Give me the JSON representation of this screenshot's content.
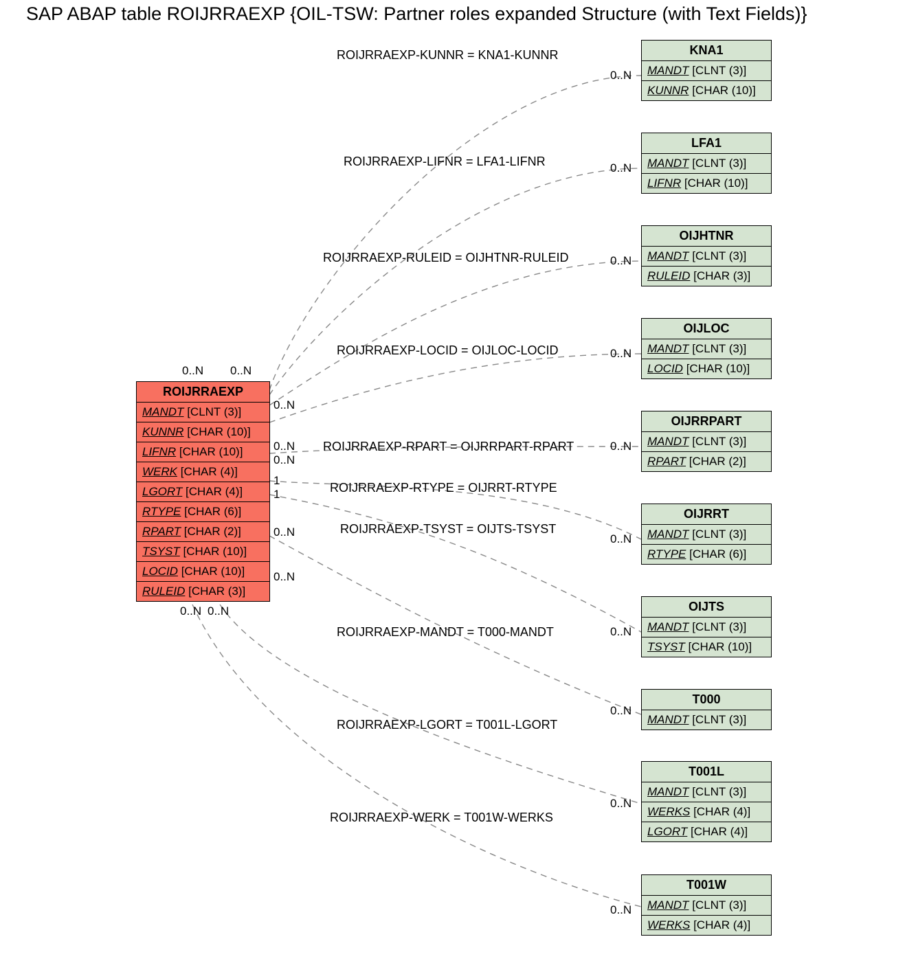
{
  "title": "SAP ABAP table ROIJRRAEXP {OIL-TSW: Partner roles expanded Structure (with Text Fields)}",
  "main_entity": {
    "name": "ROIJRRAEXP",
    "fields": [
      {
        "name": "MANDT",
        "type": "[CLNT (3)]"
      },
      {
        "name": "KUNNR",
        "type": "[CHAR (10)]"
      },
      {
        "name": "LIFNR",
        "type": "[CHAR (10)]"
      },
      {
        "name": "WERK",
        "type": "[CHAR (4)]"
      },
      {
        "name": "LGORT",
        "type": "[CHAR (4)]"
      },
      {
        "name": "RTYPE",
        "type": "[CHAR (6)]"
      },
      {
        "name": "RPART",
        "type": "[CHAR (2)]"
      },
      {
        "name": "TSYST",
        "type": "[CHAR (10)]"
      },
      {
        "name": "LOCID",
        "type": "[CHAR (10)]"
      },
      {
        "name": "RULEID",
        "type": "[CHAR (3)]"
      }
    ]
  },
  "related_entities": [
    {
      "name": "KNA1",
      "fields": [
        {
          "name": "MANDT",
          "type": "[CLNT (3)]"
        },
        {
          "name": "KUNNR",
          "type": "[CHAR (10)]"
        }
      ]
    },
    {
      "name": "LFA1",
      "fields": [
        {
          "name": "MANDT",
          "type": "[CLNT (3)]"
        },
        {
          "name": "LIFNR",
          "type": "[CHAR (10)]"
        }
      ]
    },
    {
      "name": "OIJHTNR",
      "fields": [
        {
          "name": "MANDT",
          "type": "[CLNT (3)]"
        },
        {
          "name": "RULEID",
          "type": "[CHAR (3)]"
        }
      ]
    },
    {
      "name": "OIJLOC",
      "fields": [
        {
          "name": "MANDT",
          "type": "[CLNT (3)]"
        },
        {
          "name": "LOCID",
          "type": "[CHAR (10)]"
        }
      ]
    },
    {
      "name": "OIJRRPART",
      "fields": [
        {
          "name": "MANDT",
          "type": "[CLNT (3)]"
        },
        {
          "name": "RPART",
          "type": "[CHAR (2)]"
        }
      ]
    },
    {
      "name": "OIJRRT",
      "fields": [
        {
          "name": "MANDT",
          "type": "[CLNT (3)]"
        },
        {
          "name": "RTYPE",
          "type": "[CHAR (6)]"
        }
      ]
    },
    {
      "name": "OIJTS",
      "fields": [
        {
          "name": "MANDT",
          "type": "[CLNT (3)]"
        },
        {
          "name": "TSYST",
          "type": "[CHAR (10)]"
        }
      ]
    },
    {
      "name": "T000",
      "fields": [
        {
          "name": "MANDT",
          "type": "[CLNT (3)]"
        }
      ]
    },
    {
      "name": "T001L",
      "fields": [
        {
          "name": "MANDT",
          "type": "[CLNT (3)]"
        },
        {
          "name": "WERKS",
          "type": "[CHAR (4)]"
        },
        {
          "name": "LGORT",
          "type": "[CHAR (4)]"
        }
      ]
    },
    {
      "name": "T001W",
      "fields": [
        {
          "name": "MANDT",
          "type": "[CLNT (3)]"
        },
        {
          "name": "WERKS",
          "type": "[CHAR (4)]"
        }
      ]
    }
  ],
  "relations": [
    {
      "label": "ROIJRRAEXP-KUNNR = KNA1-KUNNR",
      "left_card": "0..N",
      "right_card": "0..N"
    },
    {
      "label": "ROIJRRAEXP-LIFNR = LFA1-LIFNR",
      "left_card": "0..N",
      "right_card": "0..N"
    },
    {
      "label": "ROIJRRAEXP-RULEID = OIJHTNR-RULEID",
      "left_card": "0..N",
      "right_card": "0..N"
    },
    {
      "label": "ROIJRRAEXP-LOCID = OIJLOC-LOCID",
      "left_card": "0..N",
      "right_card": "0..N"
    },
    {
      "label": "ROIJRRAEXP-RPART = OIJRRPART-RPART",
      "left_card": "0..N",
      "right_card": "0..N"
    },
    {
      "label": "ROIJRRAEXP-RTYPE = OIJRRT-RTYPE",
      "left_card": "1",
      "right_card": "1"
    },
    {
      "label": "ROIJRRAEXP-TSYST = OIJTS-TSYST",
      "left_card": "0..N",
      "right_card": "0..N"
    },
    {
      "label": "ROIJRRAEXP-MANDT = T000-MANDT",
      "left_card": "0..N",
      "right_card": "0..N"
    },
    {
      "label": "ROIJRRAEXP-LGORT = T001L-LGORT",
      "left_card": "0..N",
      "right_card": "0..N"
    },
    {
      "label": "ROIJRRAEXP-WERK = T001W-WERKS",
      "left_card": "0..N",
      "right_card": "0..N"
    }
  ],
  "chart_data": {
    "type": "er-diagram",
    "main": "ROIJRRAEXP",
    "main_fields": [
      "MANDT CLNT(3)",
      "KUNNR CHAR(10)",
      "LIFNR CHAR(10)",
      "WERK CHAR(4)",
      "LGORT CHAR(4)",
      "RTYPE CHAR(6)",
      "RPART CHAR(2)",
      "TSYST CHAR(10)",
      "LOCID CHAR(10)",
      "RULEID CHAR(3)"
    ],
    "links": [
      {
        "from": "ROIJRRAEXP.KUNNR",
        "to": "KNA1.KUNNR",
        "card": "0..N - 0..N"
      },
      {
        "from": "ROIJRRAEXP.LIFNR",
        "to": "LFA1.LIFNR",
        "card": "0..N - 0..N"
      },
      {
        "from": "ROIJRRAEXP.RULEID",
        "to": "OIJHTNR.RULEID",
        "card": "0..N - 0..N"
      },
      {
        "from": "ROIJRRAEXP.LOCID",
        "to": "OIJLOC.LOCID",
        "card": "0..N - 0..N"
      },
      {
        "from": "ROIJRRAEXP.RPART",
        "to": "OIJRRPART.RPART",
        "card": "0..N - 0..N"
      },
      {
        "from": "ROIJRRAEXP.RTYPE",
        "to": "OIJRRT.RTYPE",
        "card": "1 - 1"
      },
      {
        "from": "ROIJRRAEXP.TSYST",
        "to": "OIJTS.TSYST",
        "card": "0..N - 0..N"
      },
      {
        "from": "ROIJRRAEXP.MANDT",
        "to": "T000.MANDT",
        "card": "0..N - 0..N"
      },
      {
        "from": "ROIJRRAEXP.LGORT",
        "to": "T001L.LGORT",
        "card": "0..N - 0..N"
      },
      {
        "from": "ROIJRRAEXP.WERK",
        "to": "T001W.WERKS",
        "card": "0..N - 0..N"
      }
    ]
  }
}
